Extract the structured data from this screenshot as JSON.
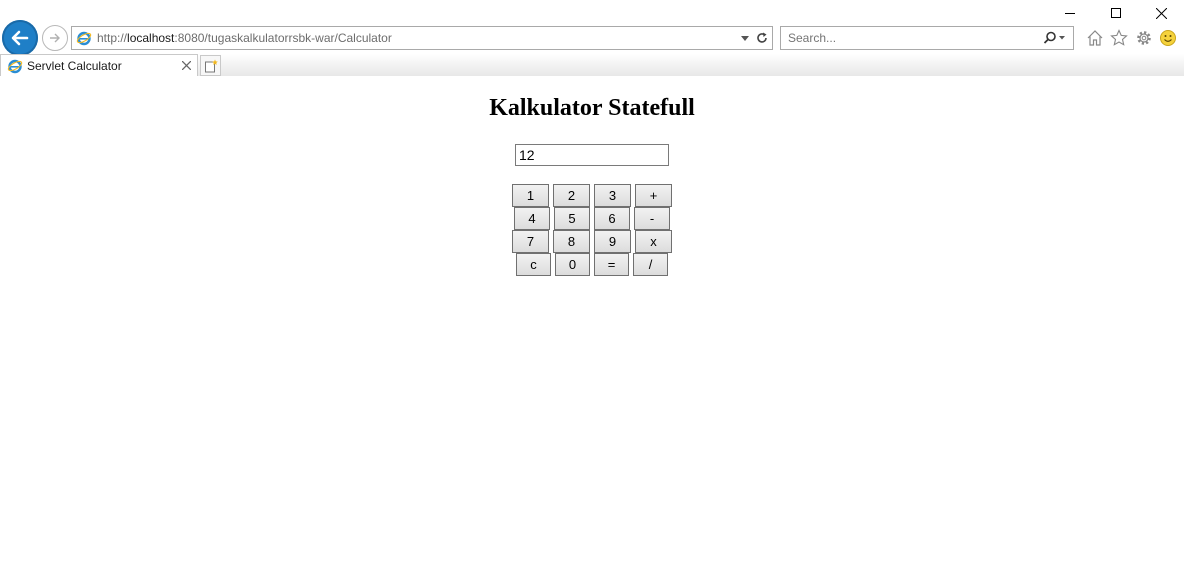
{
  "browser": {
    "address_url_prefix": "http://",
    "address_url_host": "localhost",
    "address_url_rest": ":8080/tugaskalkulatorrsbk-war/Calculator",
    "search_placeholder": "Search...",
    "tab_title": "Servlet Calculator",
    "accent_color": "#1f7fc7",
    "icons": [
      "back-arrow-icon",
      "forward-arrow-icon",
      "ie-logo-icon",
      "dropdown-icon",
      "refresh-icon",
      "search-icon",
      "home-icon",
      "favorites-star-icon",
      "settings-gear-icon",
      "smiley-feedback-icon",
      "close-icon",
      "new-tab-icon",
      "minimize-icon",
      "maximize-icon",
      "window-close-icon"
    ]
  },
  "page": {
    "heading": "Kalkulator Statefull",
    "display_value": "12",
    "keypad": {
      "rows": [
        [
          "1",
          "2",
          "3",
          "+"
        ],
        [
          "4",
          "5",
          "6",
          "-"
        ],
        [
          "7",
          "8",
          "9",
          "x"
        ],
        [
          "c",
          "0",
          "=",
          "/"
        ]
      ]
    }
  }
}
